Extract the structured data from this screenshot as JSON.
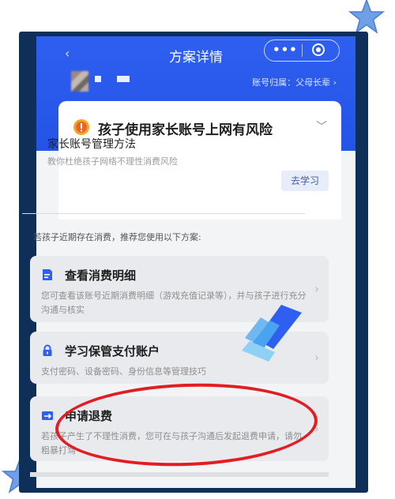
{
  "nav": {
    "title": "方案详情",
    "back_icon": "back-icon",
    "more_icon": "more-icon",
    "close_icon": "target-icon"
  },
  "account": {
    "owner_label": "账号归属：父母长辈 ›"
  },
  "risk_card": {
    "title": "孩子使用家长账号上网有风险",
    "method_title": "家长账号管理方法",
    "method_desc": "教你杜绝孩子网络不理性消费风险",
    "learn_label": "去学习"
  },
  "suggestion": "若孩子近期存在消费，推荐您使用以下方案:",
  "options": [
    {
      "icon": "document-icon",
      "title": "查看消费明细",
      "desc": "您可查看该账号近期消费明细（游戏充值记录等），并与孩子进行充分沟通与核实"
    },
    {
      "icon": "lock-icon",
      "title": "学习保管支付账户",
      "desc": "支付密码、设备密码、身份信息等管理技巧"
    },
    {
      "icon": "refund-icon",
      "title": "申请退费",
      "desc": "若孩子产生了不理性消费，您可在与孩子沟通后发起退费申请，请勿粗暴打骂"
    }
  ],
  "colors": {
    "header_blue": "#2454e6",
    "frame_navy": "#0e2f58",
    "highlight_red": "#e21d24",
    "star_blue": "#6f9fe6"
  }
}
